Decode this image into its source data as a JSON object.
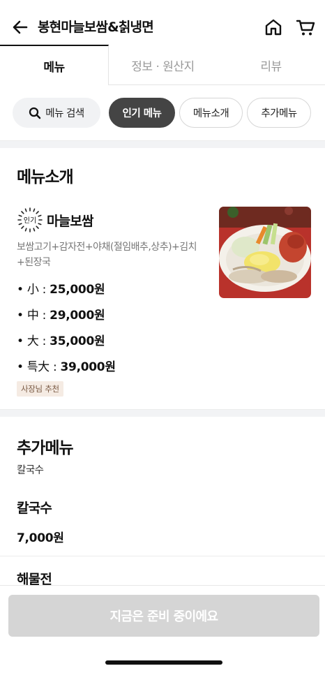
{
  "header": {
    "title": "봉현마늘보쌈&칡냉면",
    "back_icon": "arrow-left-icon",
    "home_icon": "home-icon",
    "cart_icon": "cart-icon"
  },
  "tabs": [
    {
      "label": "메뉴",
      "active": true
    },
    {
      "label": "정보 · 원산지",
      "active": false
    },
    {
      "label": "리뷰",
      "active": false
    }
  ],
  "chips": {
    "search": "메뉴 검색",
    "items": [
      {
        "label": "인기 메뉴",
        "selected": true
      },
      {
        "label": "메뉴소개",
        "selected": false
      },
      {
        "label": "추가메뉴",
        "selected": false
      }
    ]
  },
  "section1": {
    "title": "메뉴소개",
    "item": {
      "badge": "인기",
      "name": "마늘보쌈",
      "description": "보쌈고기+감자전+야채(절임배추,상추)+김치+된장국",
      "prices": [
        {
          "label": "• 小 : ",
          "value": "25,000원"
        },
        {
          "label": "• 中 : ",
          "value": "29,000원"
        },
        {
          "label": "• 大 : ",
          "value": "35,000원"
        },
        {
          "label": "• 특大 : ",
          "value": "39,000원"
        }
      ],
      "tag": "사장님 추천"
    }
  },
  "section2": {
    "title": "추가메뉴",
    "subtitle": "칼국수",
    "items": [
      {
        "name": "칼국수",
        "price": "7,000원"
      },
      {
        "name": "해물전",
        "price": ""
      }
    ]
  },
  "cta": {
    "label": "지금은 준비 중이에요"
  },
  "colors": {
    "selected_chip": "#444444",
    "cta_disabled": "#d5d5d5",
    "tag_bg": "#f5ebe3"
  }
}
